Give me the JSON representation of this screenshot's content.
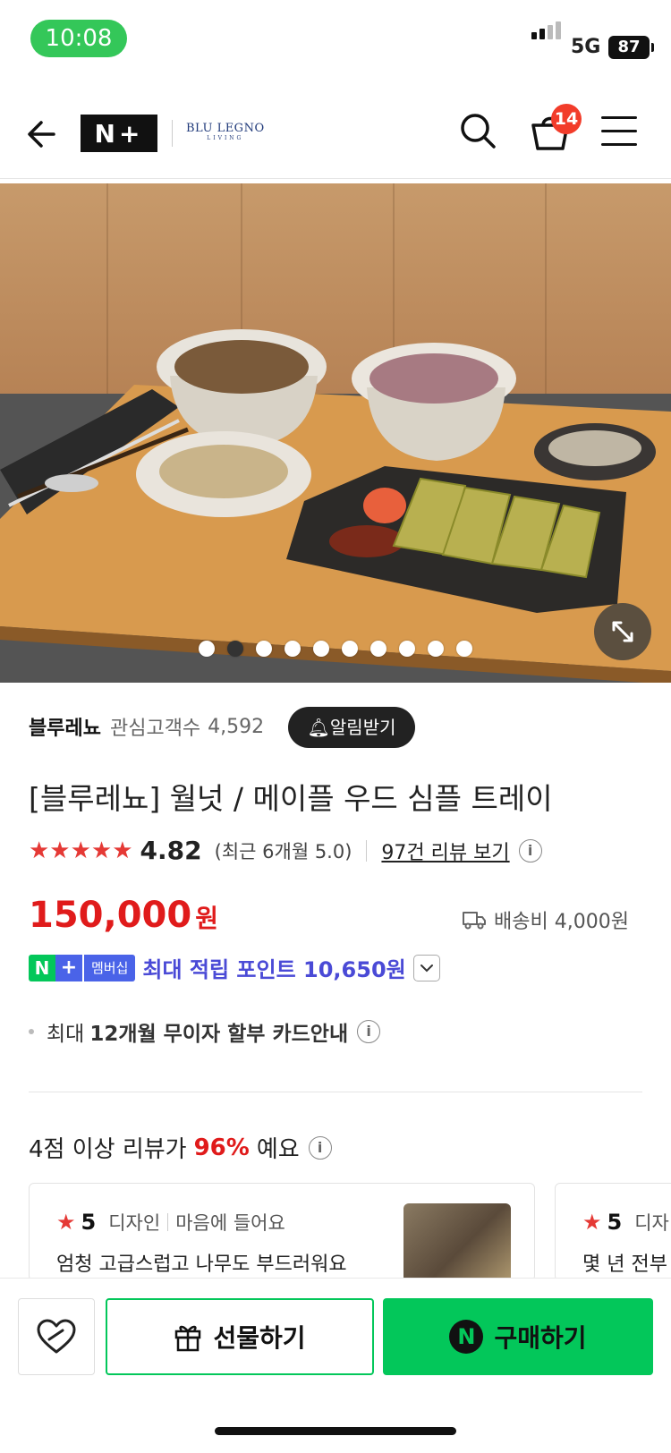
{
  "status_bar": {
    "time": "10:08",
    "network": "5G",
    "battery": "87"
  },
  "header": {
    "logo": "N+",
    "brand": "BLU LEGNO",
    "brand_sub": "LIVING",
    "cart_count": "14",
    "icons": [
      "back-arrow-icon",
      "search-icon",
      "cart-icon",
      "menu-icon"
    ]
  },
  "gallery": {
    "image_count": 10,
    "active_index": 1
  },
  "seller": {
    "name": "블루레뇨",
    "interest_label": "관심고객수",
    "interest_count": "4,592",
    "alarm_button": "알림받기"
  },
  "product": {
    "title": "[블루레뇨] 월넛 / 메이플 우드 심플 트레이",
    "stars": "★★★★★",
    "rating": "4.82",
    "recent_rating": "(최근 6개월 5.0)",
    "review_link": "97건 리뷰 보기",
    "price": "150,000",
    "currency": "원",
    "shipping": "배송비 4,000원"
  },
  "membership": {
    "badge_n": "N",
    "badge_plus": "+",
    "badge_label": "멤버십",
    "points_text": "최대 적립 포인트 10,650원"
  },
  "installment": {
    "prefix": "최대",
    "text": "12개월 무이자 할부 카드안내"
  },
  "review_summary": {
    "prefix": "4점 이상 리뷰가",
    "percent": "96%",
    "suffix": "예요"
  },
  "review_cards": [
    {
      "star": "★",
      "score": "5",
      "tag1": "디자인",
      "tag2": "마음에 들어요",
      "text": "엄청 고급스럽고 나무도 부드러워요"
    },
    {
      "star": "★",
      "score": "5",
      "tag1": "디자",
      "text": "몇 년 전부"
    }
  ],
  "bottom_bar": {
    "gift_button": "선물하기",
    "buy_button": "구매하기",
    "buy_icon": "N"
  },
  "colors": {
    "naver_green": "#03c75a",
    "price_red": "#e01b1b",
    "points_blue": "#4a4ad6",
    "badge_red": "#f23c2a"
  }
}
